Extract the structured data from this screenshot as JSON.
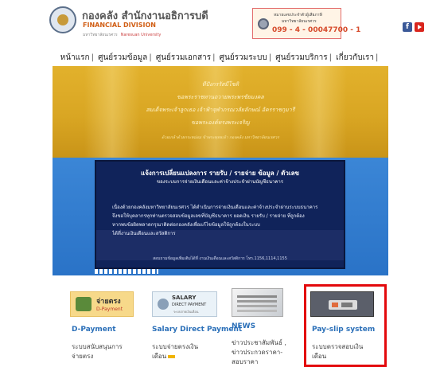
{
  "header": {
    "org_name_th": "กองคลัง สำนักงานอธิการบดี",
    "org_name_en": "FINANCIAL DIVISION",
    "org_sub_th": "มหาวิทยาลัยนเรศวร",
    "org_sub_en": "Naresuan University",
    "contact": {
      "line1": "หมายเลขประจำตัวผู้เสียภาษี",
      "line2": "มหาวิทยาลัยนเรศวร",
      "phone": "099 - 4 - 00047700 - 1"
    },
    "social": {
      "facebook_glyph": "f",
      "icons": [
        "facebook-icon",
        "youtube-icon"
      ]
    }
  },
  "nav": {
    "items": [
      "หน้าแรก",
      "ศูนย์รวมข้อมูล",
      "ศูนย์รวมเอกสาร",
      "ศูนย์รวมระบบ",
      "ศูนย์รวมบริการ",
      "เกี่ยวกับเรา"
    ],
    "separator": "|"
  },
  "banner": {
    "verse": [
      "ทีปังกรรัสมีโชติ",
      "ขอพระราชทานถวายพระพรชัยมงคล",
      "สมเด็จพระเจ้าลูกเธอ เจ้าฟ้าจุฬาภรณวลัยลักษณ์ อัครราชกุมารี",
      "ขอพระองค์ทรงพระเจริญ"
    ],
    "verse_footer": "ด้วยเกล้าด้วยกระหม่อม ข้าพระพุทธเจ้า กองคลัง มหาวิทยาลัยนเรศวร"
  },
  "notice": {
    "title": "แจ้งการเปลี่ยนแปลงการ รายรับ / รายจ่าย ข้อมูล / ตัวเลข",
    "subtitle": "ของระบบการจ่ายเงินเดือนและค่าจ้างประจำผ่านบัญชีธนาคาร",
    "body": [
      "เนื่องด้วยกองคลังมหาวิทยาลัยนเรศวร ได้ดำเนินการจ่ายเงินเดือนและค่าจ้างประจำผ่านระบบธนาคาร",
      "จึงขอให้บุคลากรทุกท่านตรวจสอบข้อมูลเลขที่บัญชีธนาคาร ยอดเงิน รายรับ / รายจ่าย ที่ถูกต้อง",
      "หากพบข้อผิดพลาดกรุณาติดต่อกองคลังเพื่อแก้ไขข้อมูลให้ถูกต้องในระบบ",
      "ได้ที่งานเงินเดือนและสวัสดิการ"
    ],
    "footer": "สอบถามข้อมูลเพิ่มเติมได้ที่ งานเงินเดือนและสวัสดิการ โทร.1156,1114,1155"
  },
  "services": [
    {
      "thumb_title": "จ่ายตรง",
      "thumb_sub": "D-Payment",
      "title": "D-Payment",
      "desc": [
        "ระบบสนับสนุนการ",
        "จ่ายตรง"
      ]
    },
    {
      "thumb_title": "SALARY",
      "thumb_sub": "DIRECT PAYMENT",
      "thumb_tiny": "ระบบจ่ายเงินเดือน",
      "title": "Salary Direct Payment",
      "desc": [
        "ระบบจ่ายตรงเงิน",
        "เดือน"
      ]
    },
    {
      "title": "NEWS",
      "desc": [
        "ข่าวประชาสัมพันธ์ ,",
        "ข่าวประกวดราคา-",
        "สอบราคา"
      ]
    },
    {
      "title": "Pay-slip system",
      "desc": [
        "ระบบตรวจสอบเงิน",
        "เดือน"
      ]
    }
  ],
  "colors": {
    "accent_link": "#2a6fb8",
    "banner_gold": "#d9a623",
    "banner_blue": "#2a73c7",
    "highlight": "#e3090c"
  }
}
